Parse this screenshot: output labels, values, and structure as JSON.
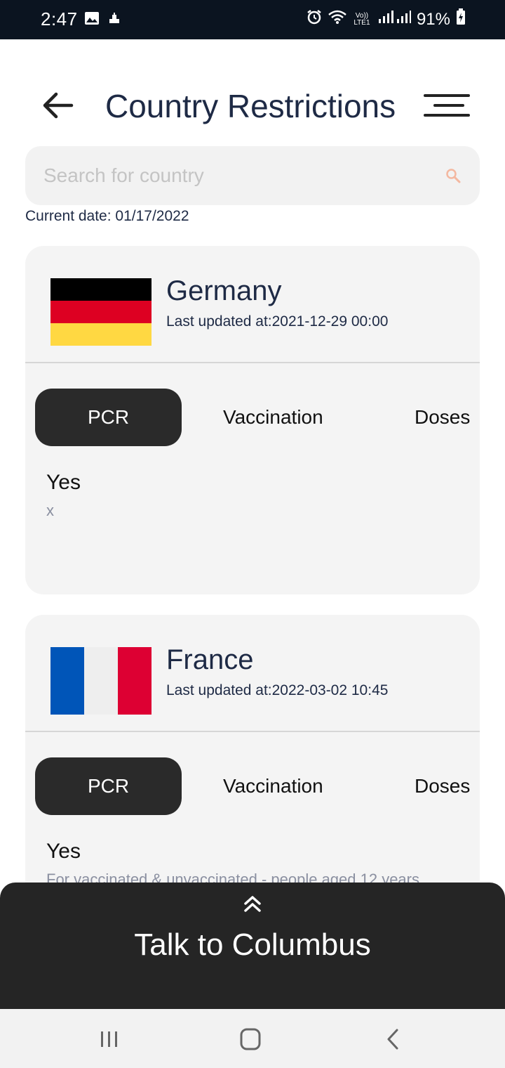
{
  "status_bar": {
    "time": "2:47",
    "battery": "91%",
    "network_label": "Vo)) LTE1",
    "icons": [
      "image-icon",
      "notification-icon",
      "alarm-icon",
      "wifi-icon",
      "signal-icon",
      "battery-icon"
    ]
  },
  "header": {
    "title": "Country Restrictions",
    "back_icon": "arrow-left-icon",
    "menu_icon": "menu-icon"
  },
  "search": {
    "placeholder": "Search for country",
    "value": ""
  },
  "current_date": "Current date: 01/17/2022",
  "countries": [
    {
      "name": "Germany",
      "updated": "Last updated at:2021-12-29 00:00",
      "flag_colors": [
        "#000000",
        "#DD0022",
        "#FFD842"
      ],
      "tabs": [
        "PCR",
        "Vaccination",
        "Doses"
      ],
      "active_tab": "PCR",
      "answer": "Yes",
      "note": "x"
    },
    {
      "name": "France",
      "updated": "Last updated at:2022-03-02 10:45",
      "flag_colors": [
        "#0055B8",
        "#EEEEEE",
        "#DD0033"
      ],
      "tabs": [
        "PCR",
        "Vaccination",
        "Doses"
      ],
      "active_tab": "PCR",
      "answer": "Yes",
      "note": "For vaccinated & unvaccinated - people aged 12 years"
    }
  ],
  "talk": {
    "label": "Talk to Columbus",
    "icon": "double-chevron-up-icon"
  },
  "navbar": {
    "buttons": [
      "recent-apps-icon",
      "home-icon",
      "back-icon"
    ]
  },
  "colors": {
    "title": "#1e2a45",
    "active_tab": "#2a2a2a",
    "card_bg": "#f4f4f4",
    "search_icon": "#f4b8a0"
  }
}
